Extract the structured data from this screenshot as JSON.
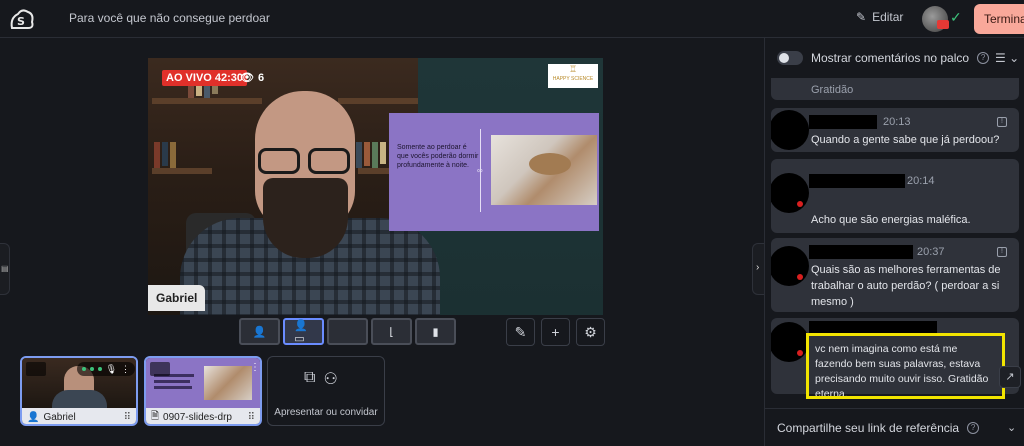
{
  "header": {
    "page_title": "Para você que não consegue perdoar",
    "edit_label": "Editar",
    "end_label": "Terminar",
    "edit_icon": "pencil-icon",
    "check_icon": "check-icon"
  },
  "stage": {
    "live_label": "AO VIVO 42:30",
    "viewer_count": "6",
    "presenter_name": "Gabriel",
    "slide_text": "Somente ao perdoar é que vocês poderão dormir profundamente à noite.",
    "brand_mark": "♖",
    "brand_text": "HAPPY SCIENCE"
  },
  "layout_buttons": [
    {
      "name": "layout-solo",
      "icon": "👤",
      "active": false
    },
    {
      "name": "layout-side",
      "icon": "👤▭",
      "active": true
    },
    {
      "name": "layout-screen",
      "icon": "",
      "active": false
    },
    {
      "name": "layout-pip",
      "icon": "⌊",
      "active": false
    },
    {
      "name": "layout-split",
      "icon": "▮",
      "active": false
    }
  ],
  "tools": {
    "pencil": "✎",
    "add": "+",
    "settings": "⚙"
  },
  "tiles": {
    "gabriel_label": "Gabriel",
    "slides_label": "0907-slides-drp",
    "invite_label": "Apresentar ou convidar"
  },
  "panel": {
    "header_label": "Mostrar comentários no palco",
    "footer_label": "Compartilhe seu link de referência",
    "partial_text": "Gratidão",
    "comments": [
      {
        "time": "20:13",
        "text": "Quando a gente sabe que já perdoou?"
      },
      {
        "time": "20:14",
        "text": "Acho que são energias maléfica."
      },
      {
        "time": "20:37",
        "text": "Quais são as melhores ferramentas de trabalhar o auto perdão? ( perdoar a si mesmo )"
      },
      {
        "time": "",
        "text": "vc nem imagina como está me fazendo bem suas palavras, estava precisando muito ouvir isso. Gratidão eterna."
      }
    ]
  },
  "colors": {
    "background": "#16181d",
    "live": "#e0302a",
    "end_button": "#f9a89a",
    "highlight": "#f2e400",
    "slide": "#8b74c5",
    "active_border": "#6a8cff"
  }
}
